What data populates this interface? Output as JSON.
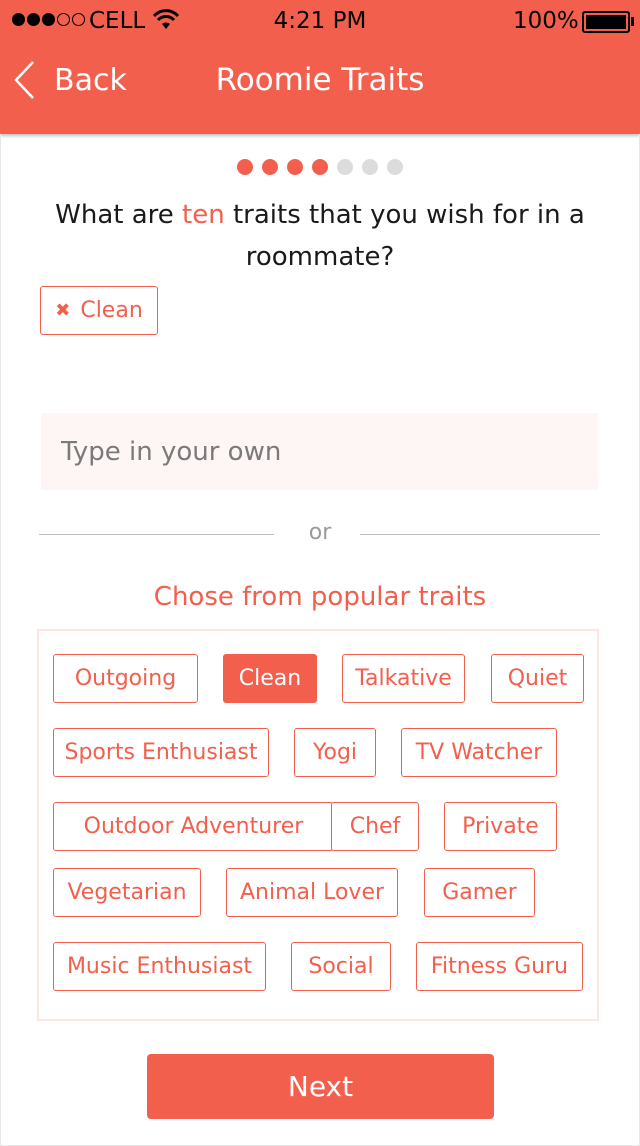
{
  "status_bar": {
    "carrier": "CELL",
    "time": "4:21 PM",
    "battery": "100%"
  },
  "nav": {
    "back_label": "Back",
    "title": "Roomie Traits"
  },
  "pager": {
    "total": 7,
    "active": 4
  },
  "question": {
    "before": "What are ",
    "accent": "ten",
    "after": " traits that you wish for in a roommate?"
  },
  "selected_traits": [
    "Clean"
  ],
  "custom_input": {
    "placeholder": "Type in your own",
    "value": ""
  },
  "divider_text": "or",
  "popular": {
    "title": "Chose from popular traits",
    "traits": [
      {
        "label": "Outgoing",
        "selected": false
      },
      {
        "label": "Clean",
        "selected": true
      },
      {
        "label": "Talkative",
        "selected": false
      },
      {
        "label": "Quiet",
        "selected": false
      },
      {
        "label": "Sports Enthusiast",
        "selected": false
      },
      {
        "label": "Yogi",
        "selected": false
      },
      {
        "label": "TV Watcher",
        "selected": false
      },
      {
        "label": "Outdoor Adventurer",
        "selected": false
      },
      {
        "label": "Chef",
        "selected": false
      },
      {
        "label": "Private",
        "selected": false
      },
      {
        "label": "Vegetarian",
        "selected": false
      },
      {
        "label": "Animal Lover",
        "selected": false
      },
      {
        "label": "Gamer",
        "selected": false
      },
      {
        "label": "Music Enthusiast",
        "selected": false
      },
      {
        "label": "Social",
        "selected": false
      },
      {
        "label": "Fitness Guru",
        "selected": false
      }
    ]
  },
  "next_label": "Next",
  "colors": {
    "accent": "#f2604d",
    "input_bg": "#fdf6f4"
  }
}
